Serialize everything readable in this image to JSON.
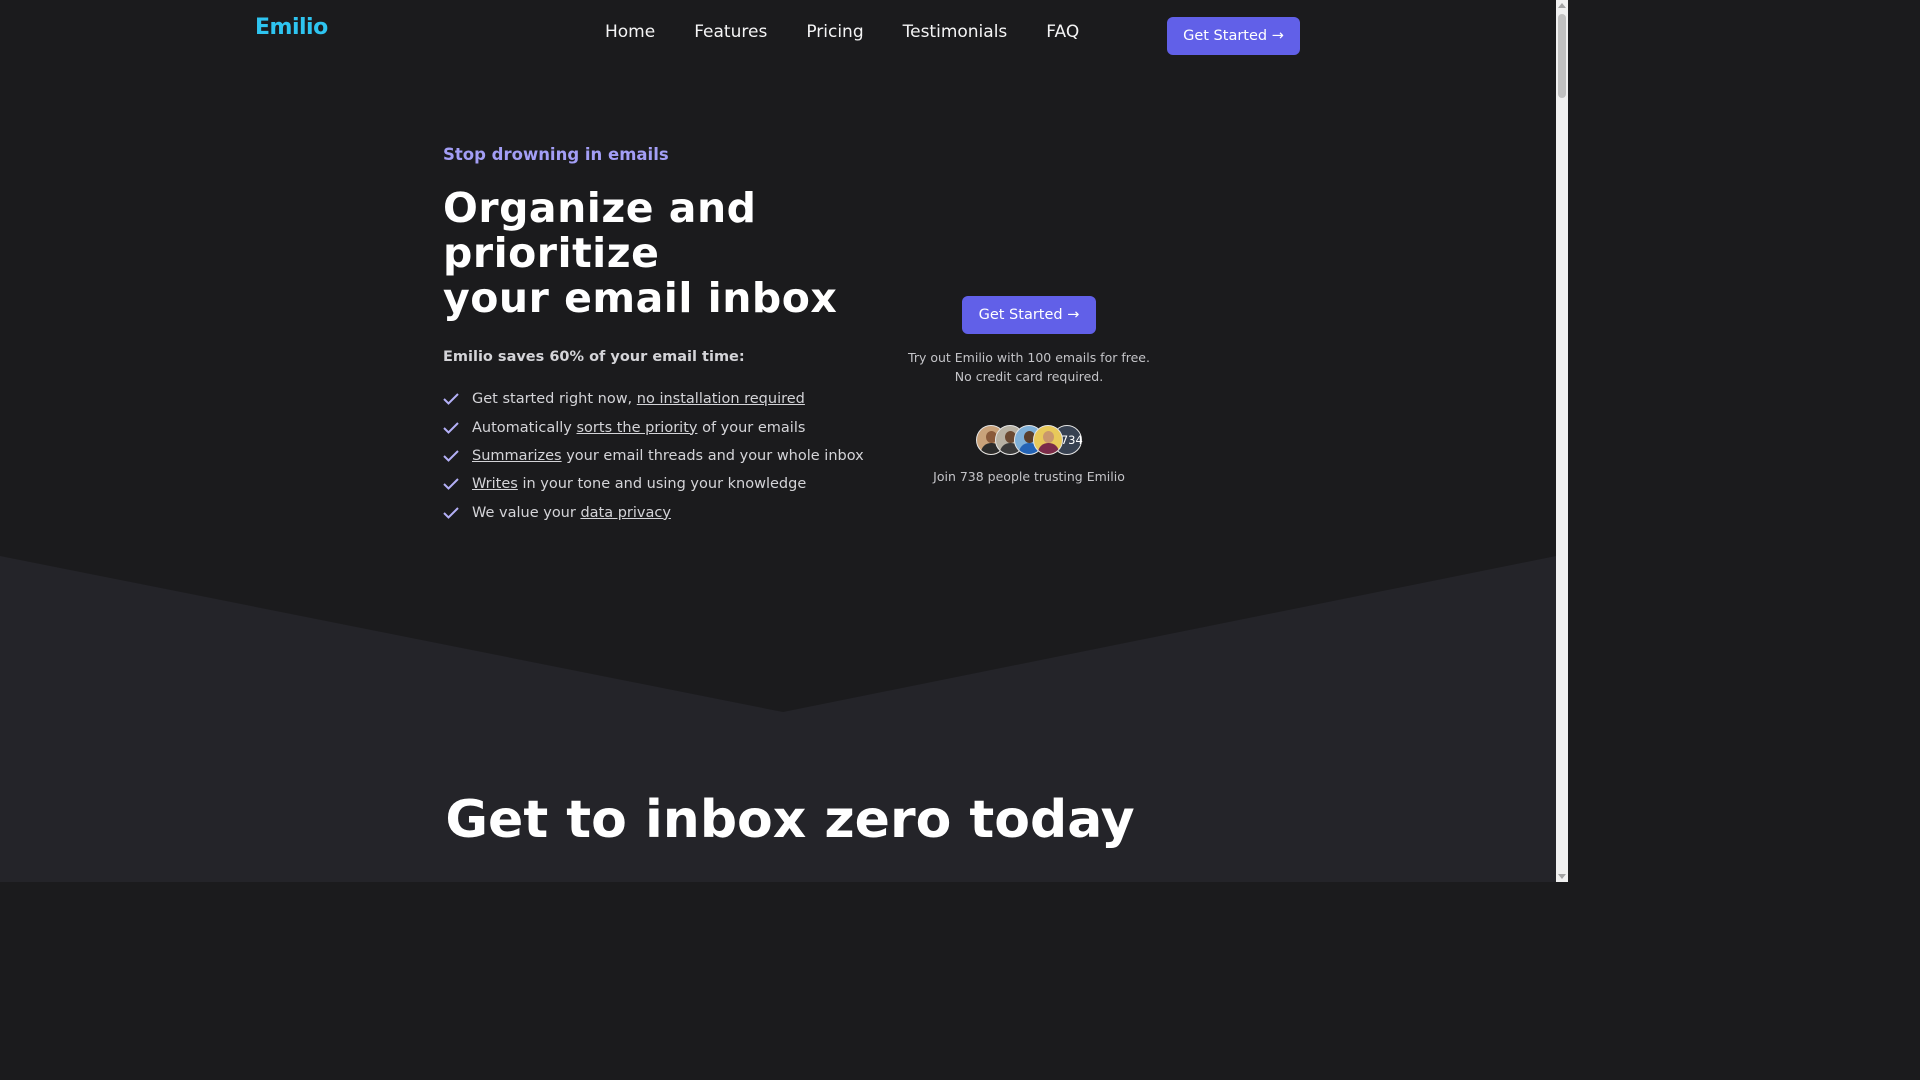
{
  "colors": {
    "background_top": "#1b1b1d",
    "background_lower": "#242429",
    "accent": "#6160e8",
    "eyebrow": "#a39ef5",
    "logo": "#2ec4f0"
  },
  "nav": {
    "logo": "Emilio",
    "links": [
      {
        "label": "Home"
      },
      {
        "label": "Features"
      },
      {
        "label": "Pricing"
      },
      {
        "label": "Testimonials"
      },
      {
        "label": "FAQ"
      }
    ],
    "cta_label": "Get Started →"
  },
  "hero": {
    "eyebrow": "Stop drowning in emails",
    "headline_lines": [
      "Organize and",
      "prioritize",
      "your email inbox"
    ],
    "subhead": "Emilio saves 60% of your email time:",
    "features": [
      {
        "pre": "Get started right now, ",
        "link": "no installation required",
        "post": ""
      },
      {
        "pre": "Automatically ",
        "link": "sorts the priority",
        "post": " of your emails"
      },
      {
        "pre": "",
        "link": "Summarizes",
        "post": " your email threads and your whole inbox"
      },
      {
        "pre": "",
        "link": "Writes",
        "post": " in your tone and using your knowledge"
      },
      {
        "pre": "We value your ",
        "link": "data privacy",
        "post": ""
      }
    ],
    "feature_icon": "check-icon",
    "cta_label": "Get Started →",
    "free_note_line1": "Try out Emilio with 100 emails for free.",
    "free_note_line2": "No credit card required.",
    "avatars": [
      {
        "name": "avatar-woman-icon",
        "bg": "#c9a27a",
        "skin": "#8a5a3b",
        "shirt": "#2b2b2b"
      },
      {
        "name": "avatar-man-icon",
        "bg": "#b8b2a4",
        "skin": "#6b4a32",
        "shirt": "#3a3a3a"
      },
      {
        "name": "avatar-man-icon",
        "bg": "#7fb0d8",
        "skin": "#5a3e2b",
        "shirt": "#2463b5"
      },
      {
        "name": "avatar-woman-icon",
        "bg": "#e8c95a",
        "skin": "#c9976d",
        "shirt": "#7a2b4a"
      }
    ],
    "avatar_more": "+734",
    "trust_text": "Join 738 people trusting Emilio"
  },
  "section": {
    "title": "Get to inbox zero today"
  }
}
